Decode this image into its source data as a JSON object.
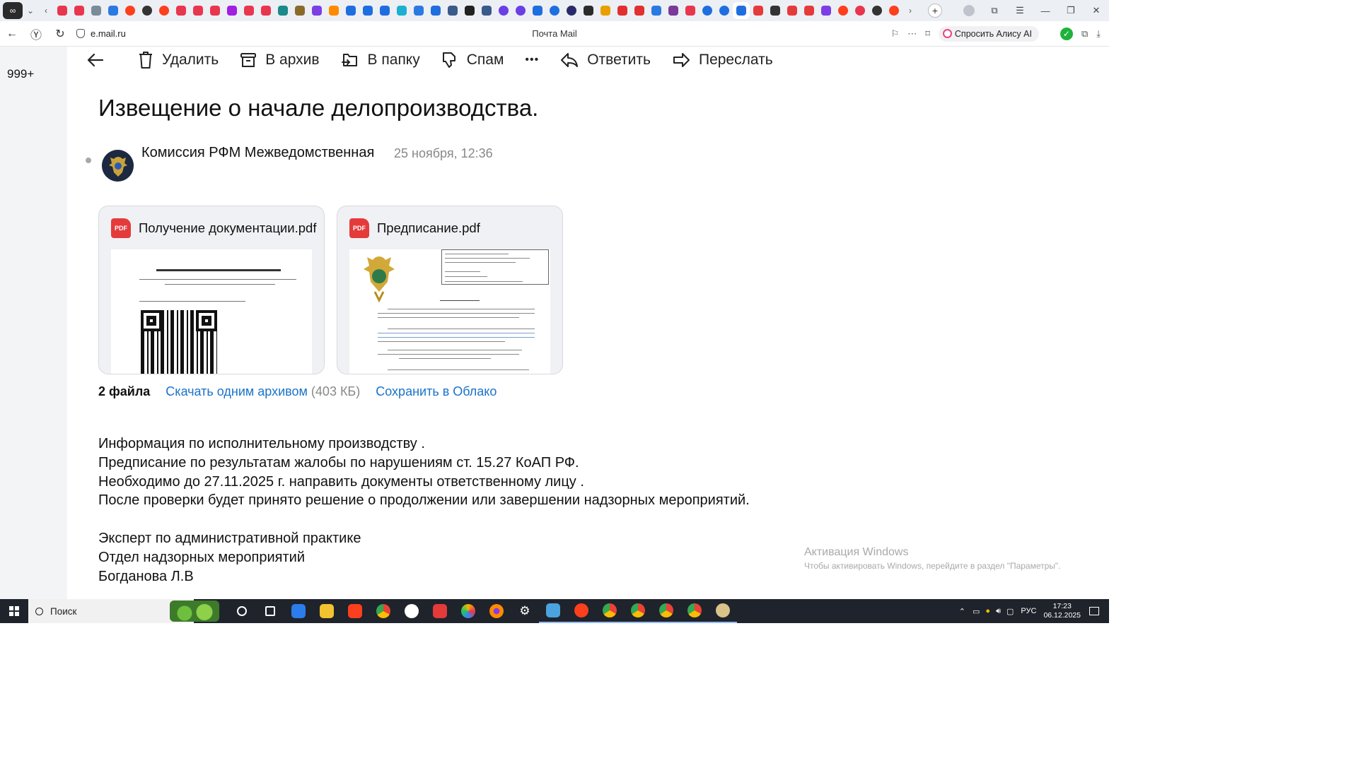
{
  "browser": {
    "url": "e.mail.ru",
    "page_title": "Почта Mail",
    "alice_button": "Спросить Алису AI"
  },
  "mail": {
    "unread_count": "999+",
    "toolbar": {
      "delete": "Удалить",
      "archive": "В архив",
      "to_folder": "В папку",
      "spam": "Спам",
      "more": "•••",
      "reply": "Ответить",
      "forward": "Переслать"
    },
    "subject": "Извещение о начале делопроизводства.",
    "sender": "Комиссия РФМ Межведомственная",
    "date": "25 ноября, 12:36",
    "attachments": [
      {
        "name": "Получение документации.pdf",
        "type": "PDF"
      },
      {
        "name": "Предписание.pdf",
        "type": "PDF"
      }
    ],
    "files_count": "2 файла",
    "download_all": "Скачать одним архивом",
    "archive_size": "(403 КБ)",
    "save_cloud": "Сохранить в Облако",
    "body": [
      "Информация по исполнительному производству .",
      "Предписание по результатам жалобы по нарушениям ст. 15.27 КоАП РФ.",
      "Необходимо до 27.11.2025 г. направить документы ответственному лицу .",
      "После проверки будет принято решение о продолжении или завершении надзорных мероприятий.",
      "",
      "Эксперт по административной практике",
      "Отдел надзорных мероприятий",
      "Богданова Л.В"
    ]
  },
  "watermark": {
    "title": "Активация Windows",
    "subtitle": "Чтобы активировать Windows, перейдите в раздел \"Параметры\"."
  },
  "taskbar": {
    "search_placeholder": "Поиск",
    "lang": "РУС",
    "time": "17:23",
    "date": "06.12.2025"
  },
  "colors": {
    "link": "#1a73c9",
    "pdf_red": "#e53a3a",
    "rail_bg": "#f3f4f6",
    "taskbar_bg": "#1f232b"
  }
}
